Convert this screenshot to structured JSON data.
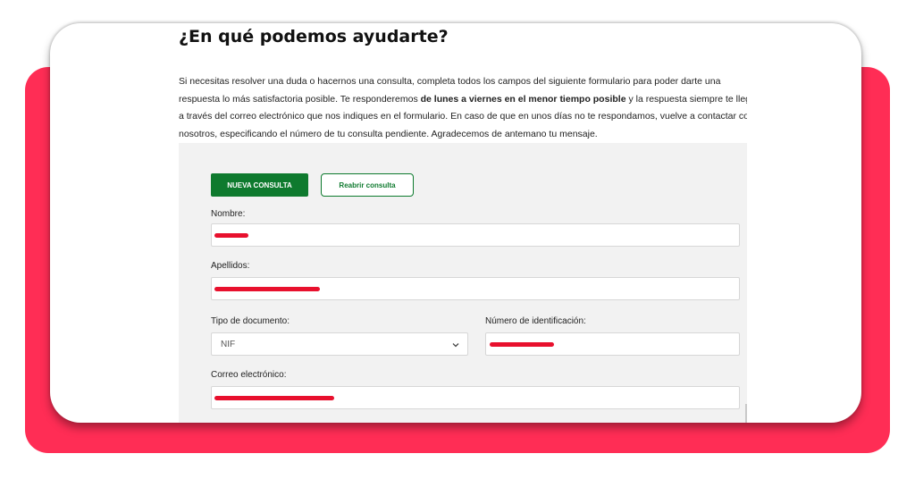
{
  "page": {
    "heading": "¿En qué podemos ayudarte?",
    "intro": {
      "line1": "Si necesitas resolver una duda o hacernos una consulta, completa todos los campos del siguiente formulario para poder darte una",
      "line2_pre": "respuesta lo más satisfactoria posible. Te responderemos ",
      "line2_bold": "de lunes a viernes en el menor tiempo posible",
      "line2_post": " y la respuesta siempre te lleg",
      "line3": "a través del correo electrónico que nos indiques en el formulario. En caso de que en unos días no te respondamos, vuelve a contactar co",
      "line4": "nosotros, especificando el número de tu consulta pendiente. Agradecemos de antemano tu mensaje."
    }
  },
  "form": {
    "buttons": {
      "new_query": "NUEVA CONSULTA",
      "reopen_query": "Reabrir consulta"
    },
    "fields": {
      "nombre_label": "Nombre:",
      "apellidos_label": "Apellidos:",
      "tipo_documento_label": "Tipo de documento:",
      "tipo_documento_value": "NIF",
      "numero_id_label": "Número de identificación:",
      "correo_label": "Correo electrónico:"
    }
  },
  "colors": {
    "accent_green": "#0e7a2e",
    "background_card": "#ff2d55",
    "redaction": "#e8102d"
  },
  "icons": {
    "select_arrow": "chevron-down-icon"
  }
}
